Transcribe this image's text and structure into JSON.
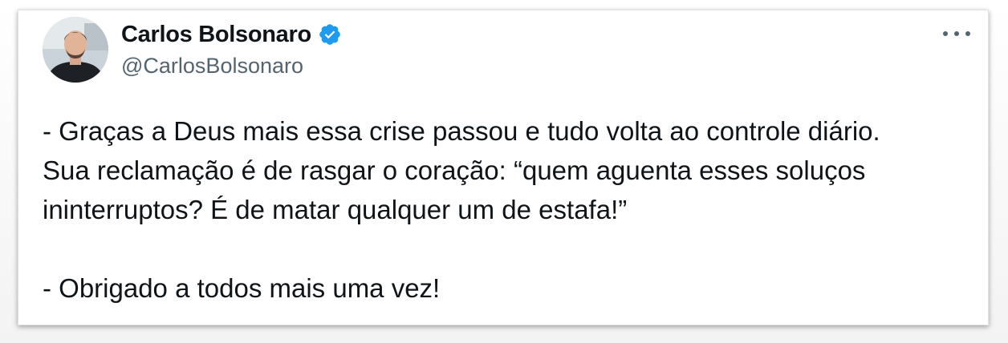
{
  "author": {
    "display_name": "Carlos Bolsonaro",
    "handle": "@CarlosBolsonaro",
    "verified": true,
    "verified_icon": "verified-badge-icon",
    "verified_color": "#1d9bf0"
  },
  "menu": {
    "icon": "more-options-icon"
  },
  "tweet": {
    "lines": [
      "- Graças a Deus mais essa crise passou e tudo volta ao controle diário.",
      "Sua reclamação é de rasgar o coração: “quem aguenta esses soluços",
      "ininterruptos? É de matar qualquer um de estafa!”",
      "- Obrigado a todos mais uma vez!"
    ]
  },
  "colors": {
    "text": "#0f1419",
    "secondary": "#536471",
    "accent": "#1d9bf0"
  }
}
